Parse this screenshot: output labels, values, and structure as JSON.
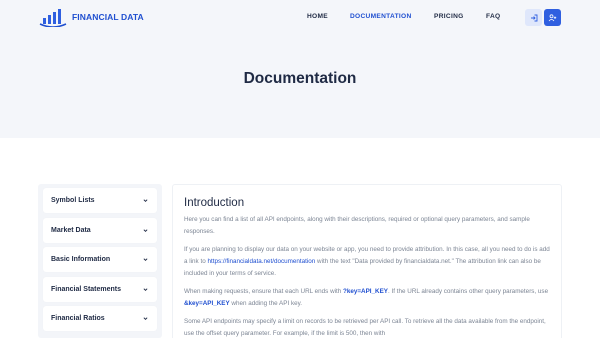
{
  "brand": {
    "name": "FINANCIAL DATA",
    "color": "#1f4fd0"
  },
  "nav": {
    "home": "HOME",
    "documentation": "DOCUMENTATION",
    "pricing": "PRICING",
    "faq": "FAQ",
    "active": "documentation"
  },
  "actions": {
    "login_icon": "login-icon",
    "signup_icon": "user-plus-icon"
  },
  "hero": {
    "title": "Documentation"
  },
  "sidebar": {
    "items": [
      {
        "label": "Symbol Lists"
      },
      {
        "label": "Market Data"
      },
      {
        "label": "Basic Information"
      },
      {
        "label": "Financial Statements"
      },
      {
        "label": "Financial Ratios"
      }
    ]
  },
  "content": {
    "heading": "Introduction",
    "p1": "Here you can find a list of all API endpoints, along with their descriptions, required or optional query parameters, and sample responses.",
    "p2_a": "If you are planning to display our data on your website or app, you need to provide attribution. In this case, all you need to do is add a link to ",
    "p2_link": "https://financialdata.net/documentation",
    "p2_b": " with the text \"Data provided by financialdata.net.\" The attribution link can also be included in your terms of service.",
    "p3_a": "When making requests, ensure that each URL ends with ",
    "p3_kw1": "?key=API_KEY",
    "p3_b": ". If the URL already contains other query parameters, use ",
    "p3_kw2": "&key=API_KEY",
    "p3_c": " when adding the API key.",
    "p4": "Some API endpoints may specify a limit on records to be retrieved per API call. To retrieve all the data available from the endpoint, use the offset query parameter. For example, if the limit is 500, then with"
  }
}
